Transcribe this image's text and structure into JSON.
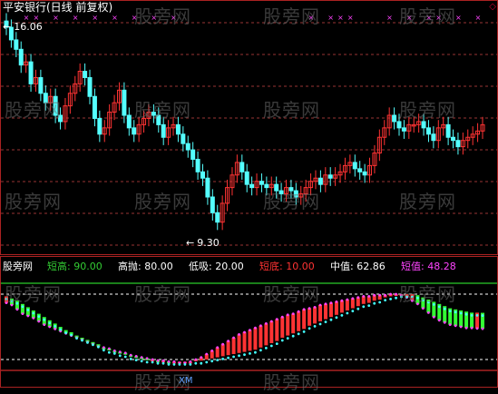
{
  "title": "平安银行(日线 前复权)",
  "high_label": "16.06",
  "low_label": "9.30",
  "high_arrow": "←",
  "low_arrow": "←",
  "watermark": "股旁网",
  "indicator": {
    "name": "股旁网",
    "items": [
      {
        "label": "短高:",
        "value": "90.00",
        "color": "#33cc33"
      },
      {
        "label": "高抛:",
        "value": "80.00",
        "color": "#ffffff"
      },
      {
        "label": "低吸:",
        "value": "20.00",
        "color": "#ffffff"
      },
      {
        "label": "短底:",
        "value": "10.00",
        "color": "#ff3333"
      },
      {
        "label": "中值:",
        "value": "62.86",
        "color": "#ffffff"
      },
      {
        "label": "短值:",
        "value": "48.28",
        "color": "#ff44ff"
      }
    ]
  },
  "bottom_label": "XM",
  "colors": {
    "up": "#ff3333",
    "down": "#54ffff",
    "grid": "#993333",
    "green": "#33ff33",
    "magenta": "#ff44ff",
    "cyan": "#44ffff",
    "red": "#ff3333"
  },
  "chart_data": {
    "type": "candlestick",
    "high": 16.06,
    "low": 9.3,
    "close": [
      16.0,
      15.6,
      15.3,
      14.8,
      14.9,
      14.2,
      14.4,
      13.9,
      13.6,
      13.8,
      13.2,
      13.0,
      13.5,
      13.9,
      14.2,
      14.6,
      14.4,
      13.8,
      13.1,
      12.6,
      12.8,
      13.3,
      13.6,
      14.0,
      13.2,
      12.8,
      12.6,
      12.9,
      13.1,
      13.3,
      13.2,
      12.9,
      12.5,
      12.8,
      12.9,
      12.6,
      12.3,
      12.1,
      11.8,
      11.4,
      11.2,
      10.6,
      10.1,
      9.8,
      10.4,
      10.9,
      11.3,
      11.7,
      11.4,
      11.0,
      10.9,
      11.1,
      11.0,
      10.9,
      11.0,
      10.8,
      10.7,
      10.9,
      10.8,
      10.6,
      10.7,
      10.9,
      11.1,
      11.2,
      11.0,
      11.3,
      11.2,
      11.3,
      11.4,
      11.6,
      11.7,
      11.5,
      11.4,
      11.3,
      11.6,
      12.0,
      12.5,
      12.8,
      13.2,
      13.0,
      12.8,
      12.7,
      12.9,
      12.9,
      13.0,
      12.8,
      12.6,
      12.4,
      12.8,
      12.9,
      12.5,
      12.4,
      12.2,
      12.4,
      12.5,
      12.6,
      12.7,
      12.9
    ],
    "indicator_levels": {
      "short_high": 90.0,
      "high_sell": 80.0,
      "low_buy": 20.0,
      "short_bottom": 10.0
    },
    "mid_value": 62.86,
    "short_value": 48.28,
    "mid_series": [
      78,
      76,
      74,
      71,
      68,
      65,
      62,
      59,
      56,
      53,
      50,
      47,
      45,
      42,
      40,
      38,
      36,
      34,
      31,
      29,
      28,
      26,
      25,
      23,
      22,
      21,
      20,
      20,
      19,
      19,
      18,
      18,
      18,
      18,
      18,
      19,
      19,
      20,
      21,
      22,
      23,
      24,
      25,
      26,
      27,
      28,
      29,
      31,
      33,
      35,
      37,
      40,
      42,
      44,
      46,
      48,
      51,
      53,
      55,
      57,
      59,
      61,
      63,
      65,
      67,
      69,
      71,
      72,
      74,
      75,
      77,
      78,
      79,
      80,
      80,
      80,
      79,
      77,
      75,
      73,
      71,
      69,
      67,
      66,
      65,
      64,
      63,
      63,
      62.86
    ],
    "short_series": [
      72,
      70,
      66,
      62,
      60,
      58,
      55,
      52,
      50,
      48,
      46,
      44,
      42,
      40,
      38,
      36,
      34,
      32,
      31,
      30,
      28,
      27,
      26,
      24,
      23,
      22,
      21,
      20,
      19,
      19,
      18,
      18,
      17,
      17,
      18,
      20,
      22,
      25,
      28,
      31,
      34,
      37,
      40,
      43,
      45,
      47,
      49,
      51,
      53,
      55,
      57,
      59,
      61,
      62,
      64,
      66,
      67,
      68,
      70,
      71,
      72,
      73,
      74,
      75,
      76,
      77,
      78,
      78,
      79,
      79,
      79,
      80,
      80,
      79,
      77,
      74,
      71,
      67,
      63,
      59,
      56,
      54,
      52,
      51,
      50,
      49,
      49,
      48.5,
      48.28
    ],
    "high_signal_days": [
      4,
      6,
      10,
      14,
      18,
      22,
      26,
      30,
      34,
      62,
      66,
      68,
      70,
      78,
      82,
      86,
      88,
      92,
      96
    ]
  }
}
